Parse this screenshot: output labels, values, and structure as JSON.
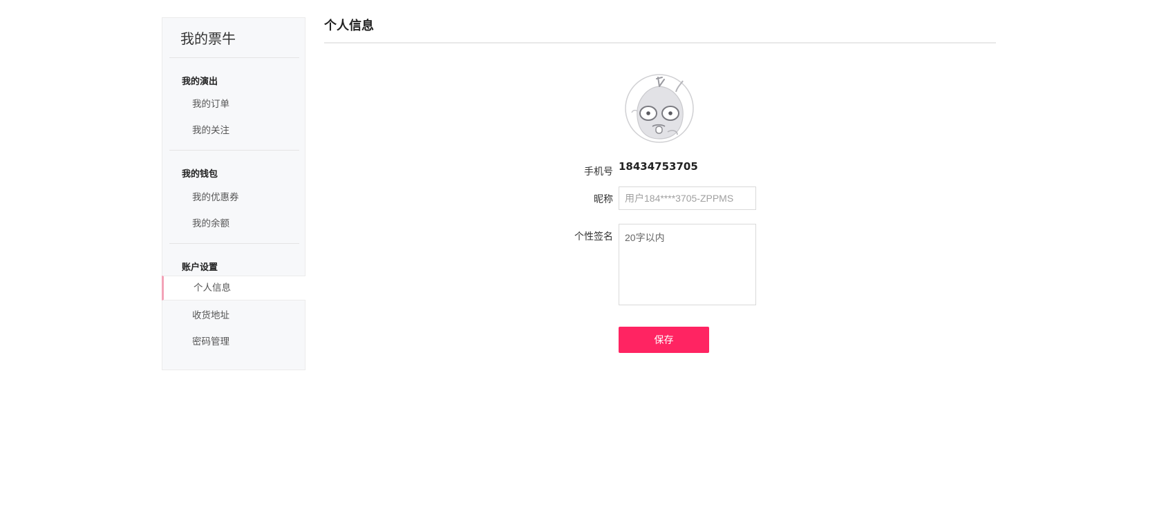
{
  "sidebar": {
    "title": "我的票牛",
    "groups": [
      {
        "heading": "我的演出",
        "items": [
          {
            "label": "我的订单"
          },
          {
            "label": "我的关注"
          }
        ]
      },
      {
        "heading": "我的钱包",
        "items": [
          {
            "label": "我的优惠券"
          },
          {
            "label": "我的余额"
          }
        ]
      },
      {
        "heading": "账户设置",
        "items": [
          {
            "label": "个人信息",
            "active": true
          },
          {
            "label": "收货地址"
          },
          {
            "label": "密码管理"
          }
        ]
      }
    ],
    "active_indicator_color": "#f3a2b7"
  },
  "main": {
    "page_title": "个人信息",
    "avatar_icon": "mascot-avatar-icon",
    "form": {
      "phone_label": "手机号",
      "phone_value": "18434753705",
      "nickname_label": "昵称",
      "nickname_placeholder": "用户184****3705-ZPPMS",
      "signature_label": "个性签名",
      "signature_placeholder": "20字以内",
      "save_label": "保存"
    },
    "accent_color": "#ff2462"
  }
}
